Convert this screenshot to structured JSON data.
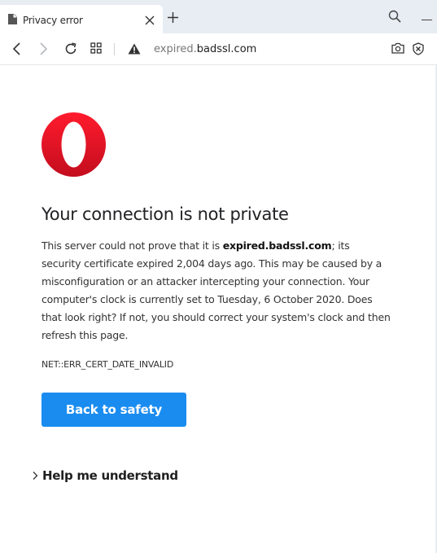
{
  "tab": {
    "title": "Privacy error"
  },
  "address_bar": {
    "url_prefix": "expired.",
    "url_host": "badssl.com"
  },
  "interstitial": {
    "heading": "Your connection is not private",
    "explanation_part1": "This server could not prove that it is ",
    "explanation_domain": "expired.badssl.com",
    "explanation_part2": "; its security certificate expired 2,004 days ago. This may be caused by a misconfiguration or an attacker intercepting your connection. Your computer's clock is currently set to Tuesday, 6 October 2020. Does that look right? If not, you should correct your system's clock and then refresh this page.",
    "error_code": "NET::ERR_CERT_DATE_INVALID",
    "primary_button": "Back to safety",
    "details_button": "Help me understand"
  },
  "colors": {
    "tabstrip_bg": "#e8ecf3",
    "primary_button_bg": "#1a8cf0",
    "opera_logo_red": "#e0162b"
  }
}
